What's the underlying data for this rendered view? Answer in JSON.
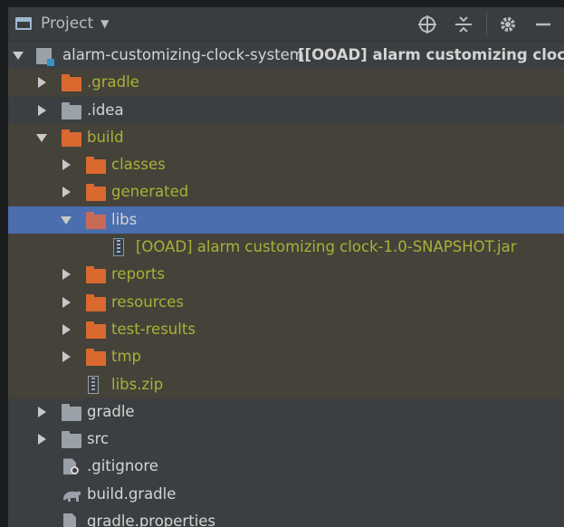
{
  "header": {
    "view_label": "Project",
    "icons": [
      "locate-icon",
      "collapse-all-icon",
      "gear-icon",
      "hide-icon"
    ]
  },
  "colors": {
    "panel_bg": "#3c3f41",
    "excluded_bg": "#45423a",
    "selection": "#4b6eaf",
    "excluded_text": "#a9b136",
    "folder_orange": "#d9692f"
  },
  "tree": {
    "root_name": "alarm-customizing-clock-system",
    "root_module": "[[OOAD] alarm customizing clock]",
    "gradle_dir": ".gradle",
    "idea_dir": ".idea",
    "build_dir": "build",
    "classes_dir": "classes",
    "generated_dir": "generated",
    "libs_dir": "libs",
    "jar_file": "[OOAD] alarm customizing clock-1.0-SNAPSHOT.jar",
    "reports_dir": "reports",
    "resources_dir": "resources",
    "test_results_dir": "test-results",
    "tmp_dir": "tmp",
    "libs_zip": "libs.zip",
    "gradle_folder": "gradle",
    "src_dir": "src",
    "gitignore": ".gitignore",
    "build_gradle": "build.gradle",
    "gradle_properties": "gradle.properties"
  }
}
